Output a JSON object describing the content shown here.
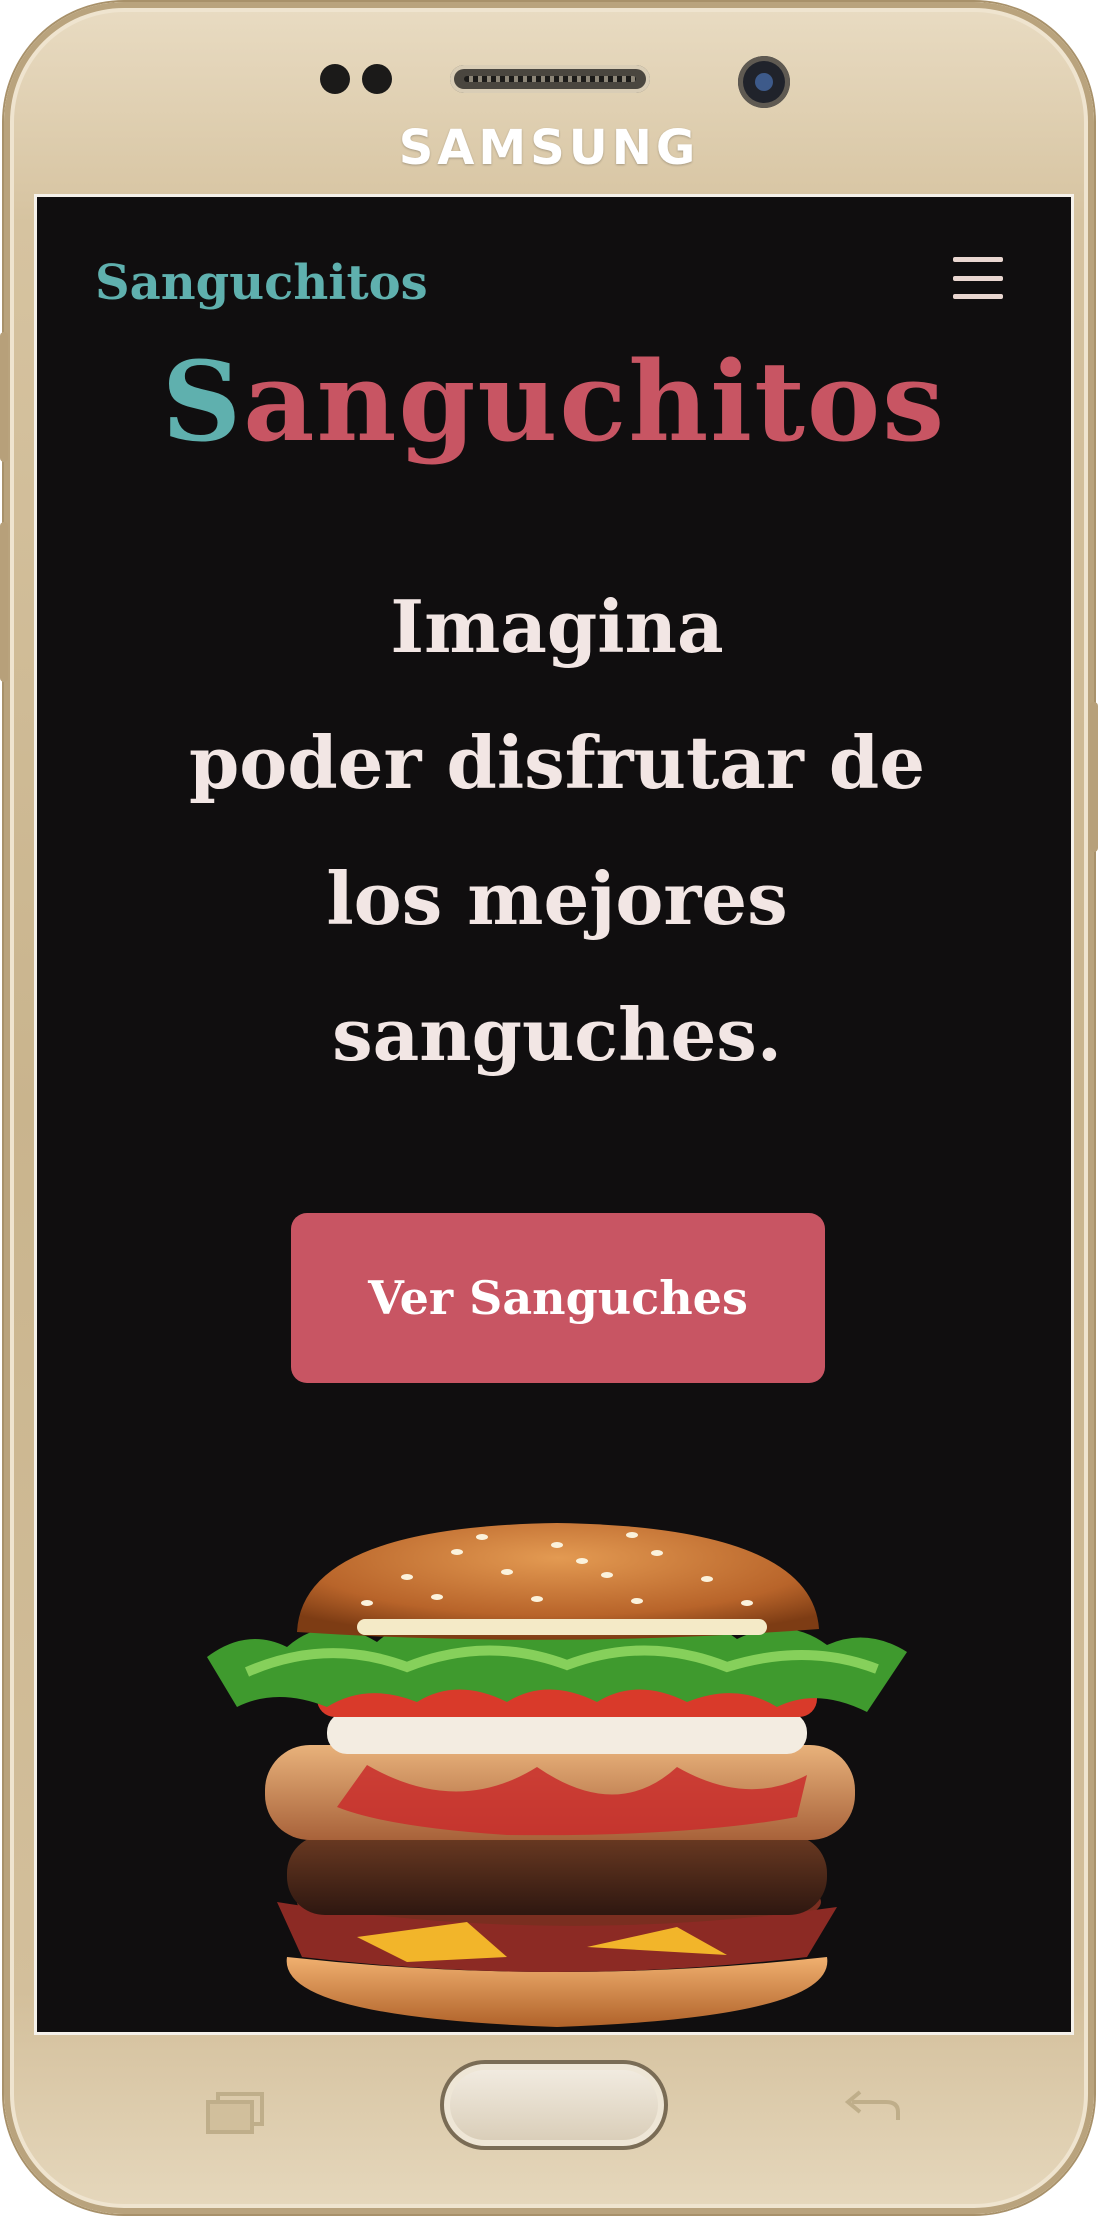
{
  "device": {
    "brand": "SAMSUNG"
  },
  "navbar": {
    "logo": "Sanguchitos",
    "menu_icon": "hamburger-menu-icon"
  },
  "hero": {
    "title_first_letter": "S",
    "title_rest": "anguchitos",
    "tagline_lines": [
      "Imagina",
      "poder disfrutar de",
      "los mejores",
      "sanguches."
    ],
    "cta_label": "Ver Sanguches",
    "image": "burger-image"
  },
  "colors": {
    "background": "#100e0f",
    "accent_teal": "#5fb0ae",
    "accent_red": "#c85563",
    "text_light": "#f2e6e4"
  }
}
